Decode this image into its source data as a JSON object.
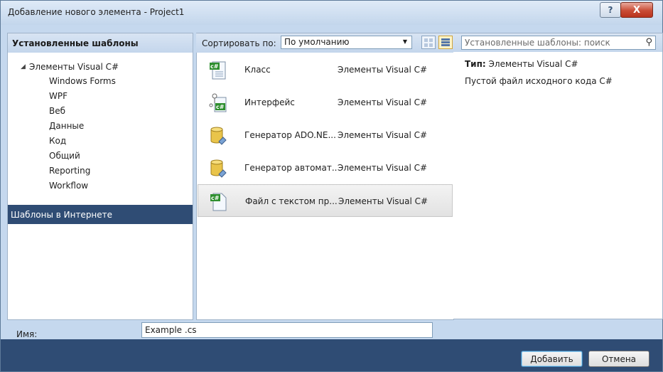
{
  "window": {
    "title": "Добавление нового элемента - Project1"
  },
  "titlebar": {
    "help_label": "?",
    "close_label": "X"
  },
  "left": {
    "header": "Установленные шаблоны",
    "root": "Элементы Visual C#",
    "items": [
      "Windows Forms",
      "WPF",
      "Веб",
      "Данные",
      "Код",
      "Общий",
      "Reporting",
      "Workflow"
    ],
    "online": "Шаблоны в Интернете"
  },
  "toolbar": {
    "sort_label": "Сортировать по:",
    "sort_value": "По умолчанию",
    "search_placeholder": "Установленные шаблоны: поиск"
  },
  "templates": [
    {
      "name": "Класс",
      "category": "Элементы Visual C#",
      "icon": "csharp-class-icon"
    },
    {
      "name": "Интерфейс",
      "category": "Элементы Visual C#",
      "icon": "csharp-interface-icon"
    },
    {
      "name": "Генератор ADO.NE...",
      "category": "Элементы Visual C#",
      "icon": "database-generator-icon"
    },
    {
      "name": "Генератор автомат...",
      "category": "Элементы Visual C#",
      "icon": "database-generator-icon"
    },
    {
      "name": "Файл с текстом пр...",
      "category": "Элементы Visual C#",
      "icon": "csharp-file-icon",
      "selected": true
    }
  ],
  "info": {
    "type_label": "Тип:",
    "type_value": "Элементы Visual C#",
    "description": "Пустой файл исходного кода C#"
  },
  "name_field": {
    "label": "Имя:",
    "value": "Example .cs"
  },
  "buttons": {
    "add": "Добавить",
    "cancel": "Отмена"
  },
  "colors": {
    "accent_dark": "#2f4c74",
    "panel_head": "#c4d6ec",
    "window_bg": "#c5d8ee"
  }
}
